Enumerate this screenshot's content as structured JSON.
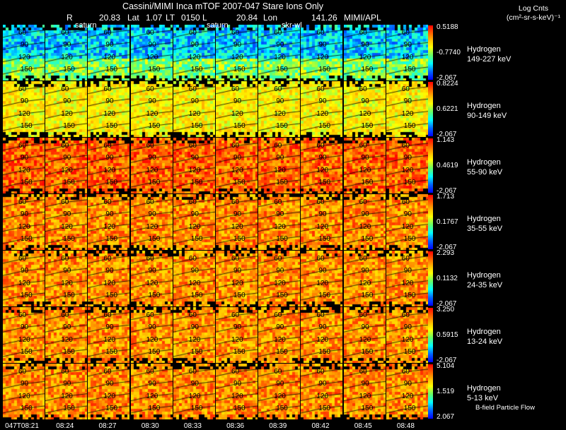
{
  "header": {
    "title": "Cassini/MIMI Inca mTOF  2007-047   Stare   Ions Only",
    "r_label": "R",
    "r_value": "20.83",
    "lat_label": "Lat",
    "lat_value": "1.07",
    "lt_label": "LT",
    "lt_value": "0150",
    "l_label": "L",
    "l_value": "20.84",
    "lon_label": "Lon",
    "lon_value": "141.26",
    "org": "MIMI/APL"
  },
  "units": {
    "line1": "Log Cnts",
    "line2": "(cm²-sr-s-keV)⁻¹"
  },
  "overlay_labels": {
    "a": "saturn",
    "b": "saturn",
    "c": "skr-wl"
  },
  "footer_note": "B-field Particle Flow",
  "colors": {
    "background": "#000000",
    "text": "#ffffff"
  },
  "chart_data": {
    "type": "heatmap",
    "title": "Cassini/MIMI Inca mTOF  2007-047   Stare   Ions Only",
    "x_axis": "time",
    "times": [
      "047T08:21",
      "08:24",
      "08:27",
      "08:30",
      "08:33",
      "08:36",
      "08:39",
      "08:42",
      "08:45",
      "08:48"
    ],
    "contour_levels": [
      "60",
      "90",
      "120",
      "150"
    ],
    "colorscale": [
      "#0000ff",
      "#0066ff",
      "#00ffff",
      "#66ff66",
      "#ffff00",
      "#ffcc00",
      "#ff6600",
      "#ff0000"
    ],
    "bands": [
      {
        "species": "Hydrogen",
        "energy": "149-227 keV",
        "max": "0.5188",
        "mid": "-0.7740",
        "min": "-2.067",
        "level": 0.35
      },
      {
        "species": "Hydrogen",
        "energy": "90-149 keV",
        "max": "0.8224",
        "mid": "0.6221",
        "min": "-2.067",
        "level": 0.62
      },
      {
        "species": "Hydrogen",
        "energy": "55-90 keV",
        "max": "1.143",
        "mid": "0.4619",
        "min": "-2.067",
        "level": 0.86
      },
      {
        "species": "Hydrogen",
        "energy": "35-55 keV",
        "max": "1.713",
        "mid": "0.1767",
        "min": "-2.067",
        "level": 0.8
      },
      {
        "species": "Hydrogen",
        "energy": "24-35 keV",
        "max": "2.293",
        "mid": "0.1132",
        "min": "-2.067",
        "level": 0.79
      },
      {
        "species": "Hydrogen",
        "energy": "13-24 keV",
        "max": "3.250",
        "mid": "0.5915",
        "min": "-2.067",
        "level": 0.79
      },
      {
        "species": "Hydrogen",
        "energy": "5-13 keV",
        "max": "5.104",
        "mid": "1.519",
        "min": "2.067",
        "level": 0.8
      }
    ]
  }
}
